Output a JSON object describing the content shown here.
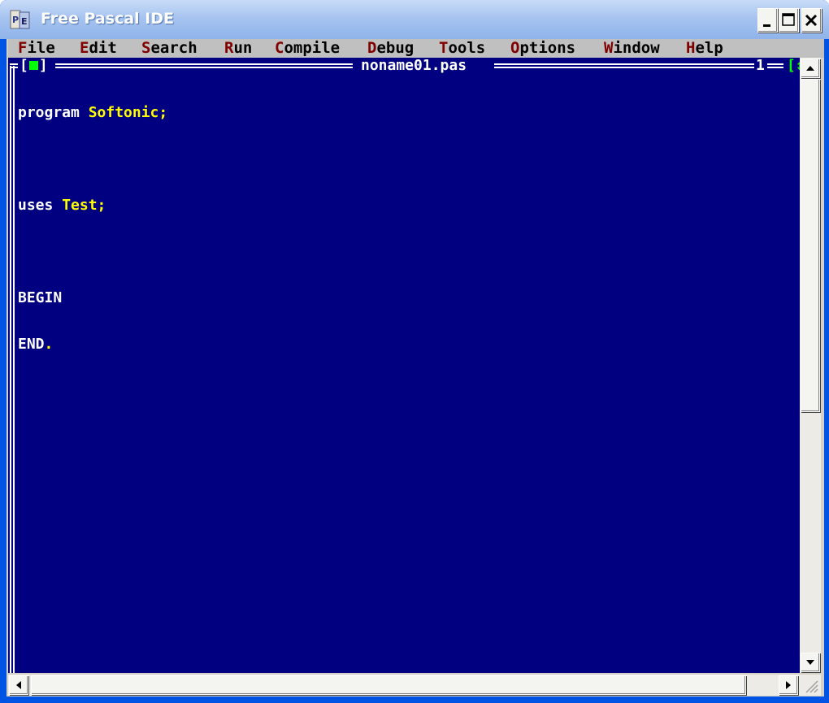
{
  "window": {
    "title": "Free Pascal IDE"
  },
  "menu": {
    "items": [
      {
        "hot": "F",
        "rest": "ile"
      },
      {
        "hot": "E",
        "rest": "dit"
      },
      {
        "hot": "S",
        "rest": "earch"
      },
      {
        "hot": "R",
        "rest": "un"
      },
      {
        "hot": "C",
        "rest": "ompile"
      },
      {
        "hot": "D",
        "rest": "ebug"
      },
      {
        "hot": "T",
        "rest": "ools"
      },
      {
        "hot": "O",
        "rest": "ptions"
      },
      {
        "hot": "W",
        "rest": "indow"
      },
      {
        "hot": "H",
        "rest": "elp"
      }
    ]
  },
  "editor": {
    "file_name": "noname01.pas",
    "window_number": "1",
    "close_box_left": "[",
    "close_box_right": "]",
    "zoom_box": "[↕",
    "lines": [
      {
        "kw": "program ",
        "id": "Softonic",
        "end": ";"
      },
      {
        "kw": "",
        "id": "",
        "end": ""
      },
      {
        "kw": "uses ",
        "id": "Test",
        "end": ";"
      },
      {
        "kw": "",
        "id": "",
        "end": ""
      },
      {
        "kw": "BEGIN",
        "id": "",
        "end": ""
      },
      {
        "kw": "END",
        "id": "",
        "end": "."
      }
    ]
  },
  "colors": {
    "editor_background": "#000080",
    "identifier": "#ffff00",
    "menu_hotkey": "#800000",
    "menu_background": "#c0c0c0"
  }
}
